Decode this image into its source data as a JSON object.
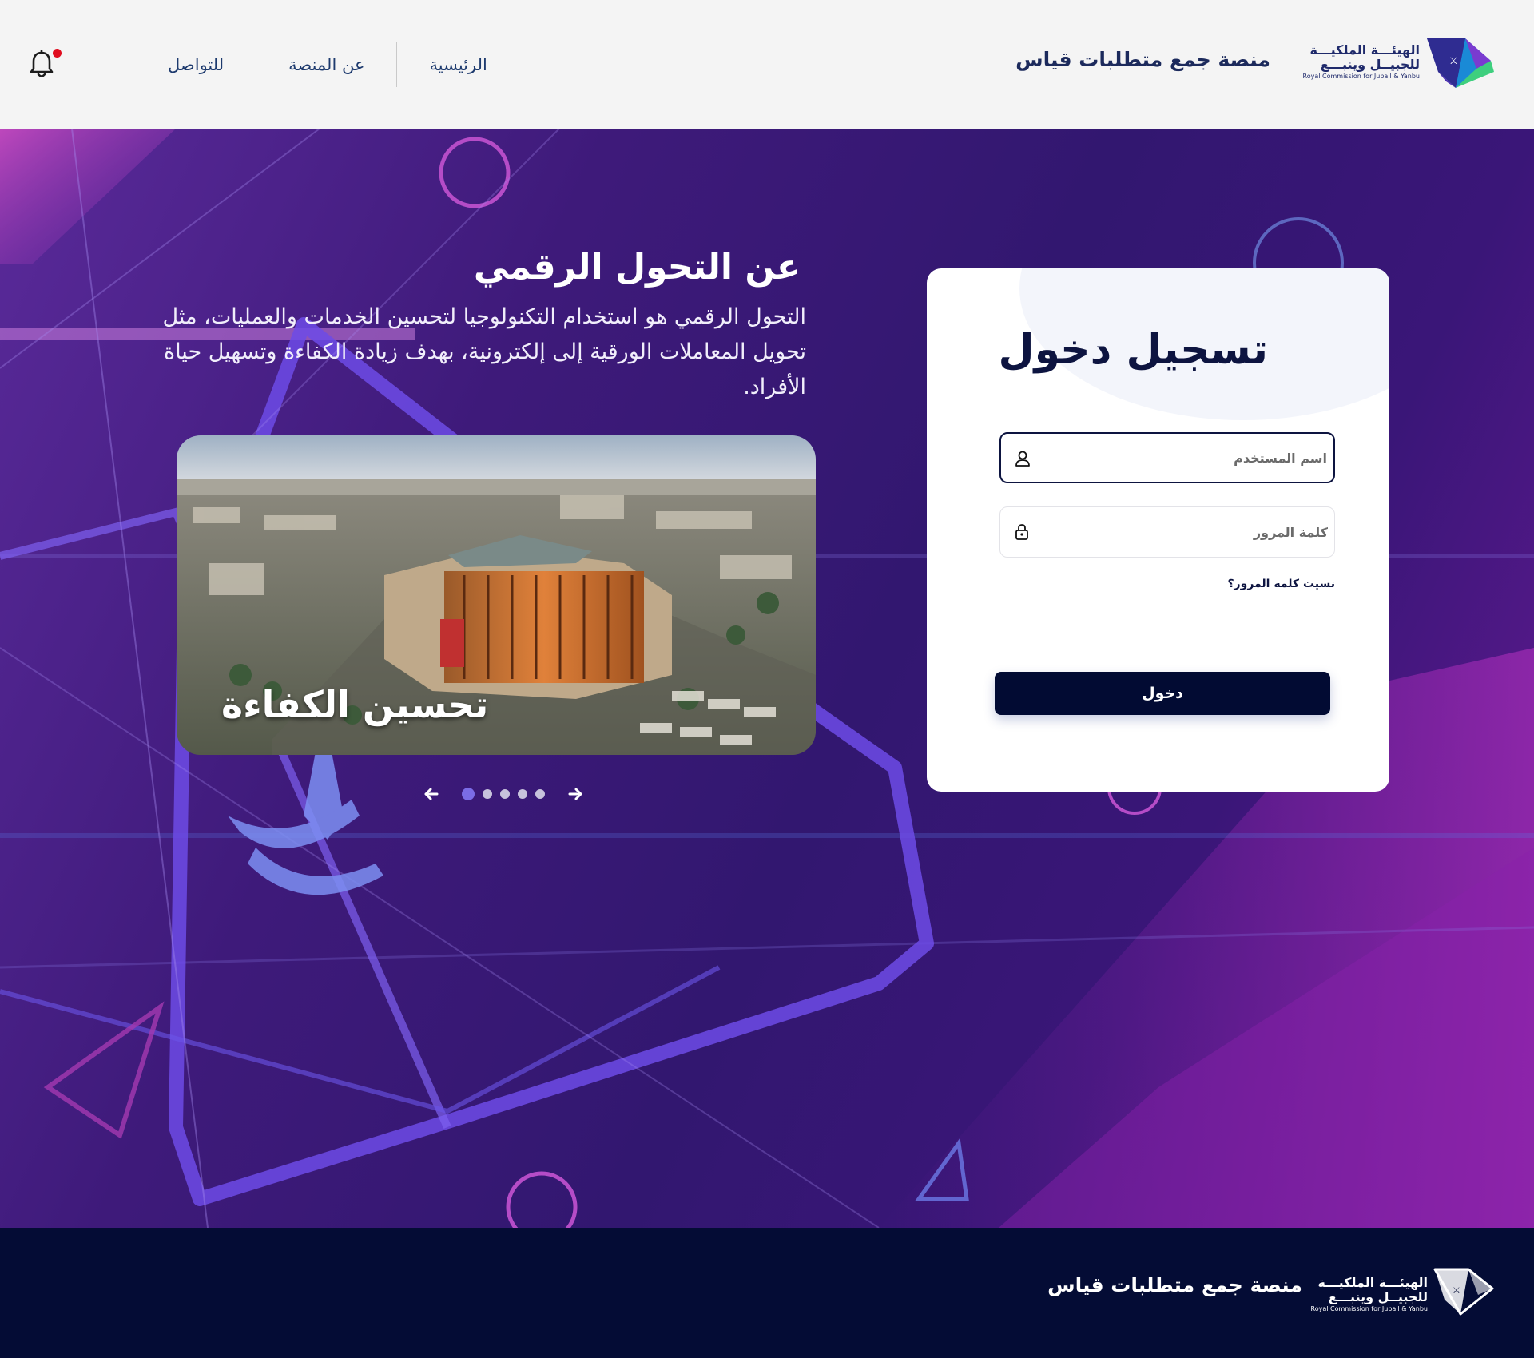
{
  "header": {
    "logo": {
      "line1": "الهيئـــة الملكيـــة",
      "line2": "للجبيــل وينبـــع",
      "english": "Royal Commission for Jubail & Yanbu"
    },
    "site_title": "منصة جمع متطلبات قياس",
    "nav": [
      {
        "label": "الرئيسية"
      },
      {
        "label": "عن المنصة"
      },
      {
        "label": "للتواصل"
      }
    ],
    "notification_icon": "bell-icon",
    "notification_dot_color": "#e00d1f"
  },
  "hero": {
    "about_title": "عن التحول الرقمي",
    "about_text": "التحول الرقمي هو استخدام التكنولوجيا لتحسين الخدمات والعمليات، مثل تحويل المعاملات الورقية إلى إلكترونية، بهدف زيادة الكفاءة وتسهيل حياة الأفراد.",
    "slide_caption": "تحسين الكفاءة",
    "carousel": {
      "slides_count": 5,
      "active_index": 0
    }
  },
  "login": {
    "title": "تسجيل دخول",
    "username_placeholder": "اسم المستخدم",
    "password_placeholder": "كلمة المرور",
    "forgot_label": "نسيت كلمة المرور؟",
    "submit_label": "دخول"
  },
  "footer": {
    "site_title": "منصة جمع متطلبات قياس",
    "logo": {
      "line1": "الهيئـــة الملكيـــة",
      "line2": "للجبيــل وينبـــع",
      "english": "Royal Commission for Jubail & Yanbu"
    }
  },
  "colors": {
    "primary_dark": "#020b33",
    "footer_bg": "#040c35",
    "hero_purple": "#3e1a7a",
    "accent_violet": "#7b6ce6"
  }
}
